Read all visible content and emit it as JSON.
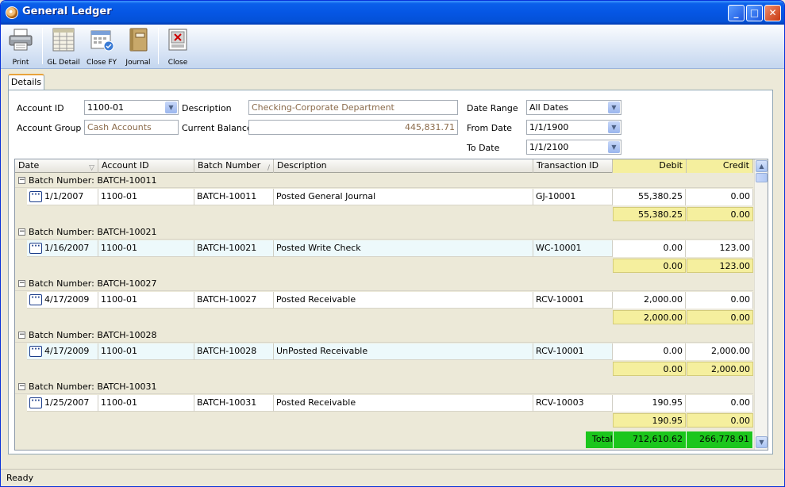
{
  "window": {
    "title": "General Ledger"
  },
  "toolbar": {
    "print": "Print",
    "gl_detail": "GL Detail",
    "close_fy": "Close FY",
    "journal": "Journal",
    "close": "Close"
  },
  "tabs": {
    "details": "Details"
  },
  "form": {
    "account_id_label": "Account ID",
    "account_id_value": "1100-01",
    "description_label": "Description",
    "description_value": "Checking-Corporate Department",
    "account_group_label": "Account Group",
    "account_group_value": "Cash Accounts",
    "current_balance_label": "Current Balance",
    "current_balance_value": "445,831.71",
    "date_range_label": "Date Range",
    "date_range_value": "All Dates",
    "from_date_label": "From Date",
    "from_date_value": "1/1/1900",
    "to_date_label": "To Date",
    "to_date_value": "1/1/2100"
  },
  "grid": {
    "columns": {
      "date": "Date",
      "account_id": "Account ID",
      "batch_number": "Batch Number",
      "description": "Description",
      "transaction_id": "Transaction ID",
      "debit": "Debit",
      "credit": "Credit"
    },
    "groups": [
      {
        "header": "Batch Number: BATCH-10011",
        "date": "1/1/2007",
        "account": "1100-01",
        "batch": "BATCH-10011",
        "description": "Posted General Journal",
        "txn": "GJ-10001",
        "debit": "55,380.25",
        "credit": "0.00",
        "sum_debit": "55,380.25",
        "sum_credit": "0.00"
      },
      {
        "header": "Batch Number: BATCH-10021",
        "date": "1/16/2007",
        "account": "1100-01",
        "batch": "BATCH-10021",
        "description": "Posted Write Check",
        "txn": "WC-10001",
        "debit": "0.00",
        "credit": "123.00",
        "sum_debit": "0.00",
        "sum_credit": "123.00"
      },
      {
        "header": "Batch Number: BATCH-10027",
        "date": "4/17/2009",
        "account": "1100-01",
        "batch": "BATCH-10027",
        "description": "Posted Receivable",
        "txn": "RCV-10001",
        "debit": "2,000.00",
        "credit": "0.00",
        "sum_debit": "2,000.00",
        "sum_credit": "0.00"
      },
      {
        "header": "Batch Number: BATCH-10028",
        "date": "4/17/2009",
        "account": "1100-01",
        "batch": "BATCH-10028",
        "description": "UnPosted Receivable",
        "txn": "RCV-10001",
        "debit": "0.00",
        "credit": "2,000.00",
        "sum_debit": "0.00",
        "sum_credit": "2,000.00"
      },
      {
        "header": "Batch Number: BATCH-10031",
        "date": "1/25/2007",
        "account": "1100-01",
        "batch": "BATCH-10031",
        "description": "Posted Receivable",
        "txn": "RCV-10003",
        "debit": "190.95",
        "credit": "0.00",
        "sum_debit": "190.95",
        "sum_credit": "0.00"
      }
    ],
    "totals": {
      "label": "Total",
      "debit": "712,610.62",
      "credit": "266,778.91"
    }
  },
  "status": {
    "text": "Ready"
  },
  "colors": {
    "summary_yellow": "#f5ef9e",
    "total_green": "#1cc61c",
    "title_blue": "#0556e4"
  }
}
